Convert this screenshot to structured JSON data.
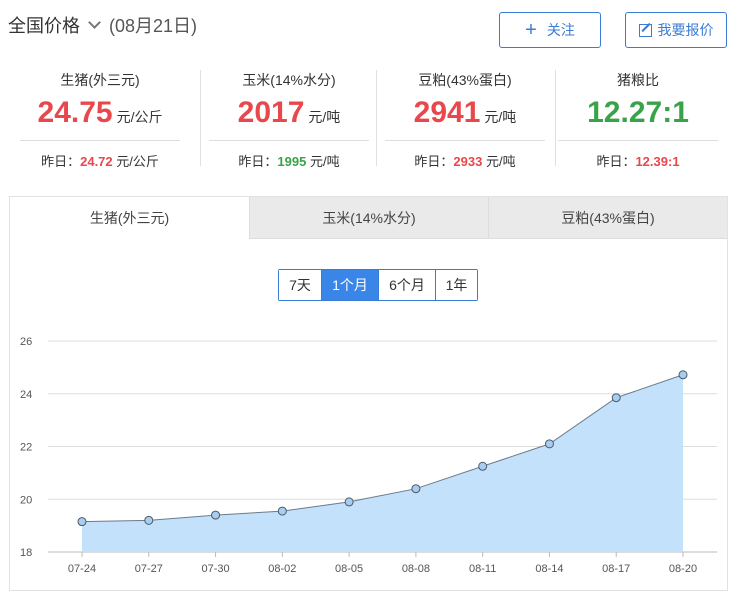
{
  "header": {
    "region_label": "全国价格",
    "date_label": "(08月21日)",
    "follow_label": "关注",
    "quote_label": "我要报价"
  },
  "stats": [
    {
      "label": "生猪(外三元)",
      "value": "24.75",
      "unit": "元/公斤",
      "value_color": "red",
      "yesterday_prefix": "昨日：",
      "yesterday_value": "24.72",
      "yesterday_unit": "元/公斤",
      "yesterday_color": "red"
    },
    {
      "label": "玉米(14%水分)",
      "value": "2017",
      "unit": "元/吨",
      "value_color": "red",
      "yesterday_prefix": "昨日：",
      "yesterday_value": "1995",
      "yesterday_unit": "元/吨",
      "yesterday_color": "green"
    },
    {
      "label": "豆粕(43%蛋白)",
      "value": "2941",
      "unit": "元/吨",
      "value_color": "red",
      "yesterday_prefix": "昨日：",
      "yesterday_value": "2933",
      "yesterday_unit": "元/吨",
      "yesterday_color": "red"
    },
    {
      "label": "猪粮比",
      "value": "12.27:1",
      "unit": "",
      "value_color": "green",
      "yesterday_prefix": "昨日：",
      "yesterday_value": "12.39:1",
      "yesterday_unit": "",
      "yesterday_color": "red"
    }
  ],
  "tabs": [
    {
      "label": "生猪(外三元)",
      "active": true
    },
    {
      "label": "玉米(14%水分)",
      "active": false
    },
    {
      "label": "豆粕(43%蛋白)",
      "active": false
    }
  ],
  "ranges": [
    {
      "label": "7天",
      "active": false
    },
    {
      "label": "1个月",
      "active": true
    },
    {
      "label": "6个月",
      "active": false
    },
    {
      "label": "1年",
      "active": false
    }
  ],
  "colors": {
    "accent": "#3a86e8",
    "up": "#e8474c",
    "down": "#3aa34a",
    "area": "#c4e1fb",
    "line": "#6b7b8c"
  },
  "chart_data": {
    "type": "area",
    "categories": [
      "07-24",
      "07-27",
      "07-30",
      "08-02",
      "08-05",
      "08-08",
      "08-11",
      "08-14",
      "08-17",
      "08-20"
    ],
    "values": [
      19.15,
      19.2,
      19.4,
      19.55,
      19.9,
      20.4,
      21.25,
      22.1,
      23.85,
      24.72
    ],
    "ylim": [
      18,
      26
    ],
    "yticks": [
      18,
      20,
      22,
      24,
      26
    ],
    "grid": true
  }
}
